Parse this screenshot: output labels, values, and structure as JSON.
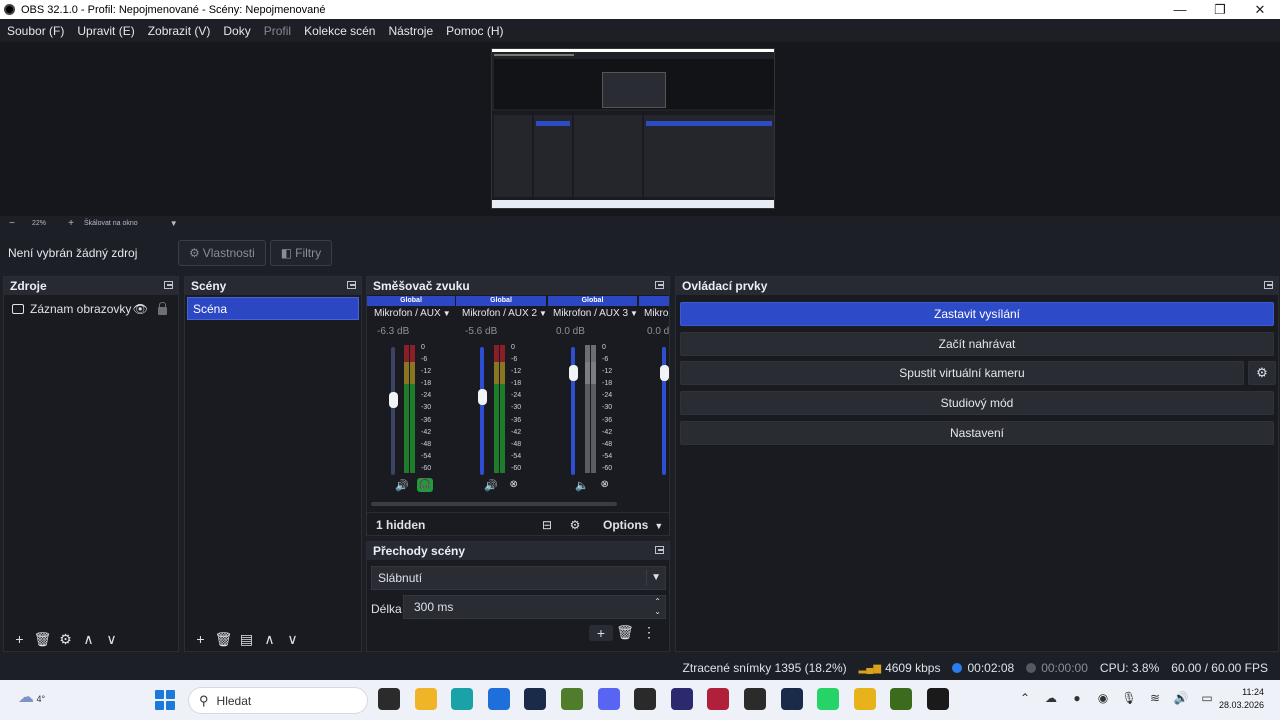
{
  "window": {
    "title": "OBS 32.1.0 - Profil: Nepojmenované - Scény: Nepojmenované",
    "minimize": "—",
    "maximize": "❐",
    "close": "✕"
  },
  "menu": [
    "Soubor (F)",
    "Upravit (E)",
    "Zobrazit (V)",
    "Doky",
    "Profil",
    "Kolekce scén",
    "Nástroje",
    "Pomoc (H)"
  ],
  "preview_bar": {
    "zoom_out": "−",
    "zoom": "22%",
    "zoom_in": "+",
    "scale_mode": "Škálovat na okno",
    "caret": "▼"
  },
  "source_bar": {
    "no_source": "Není vybrán žádný zdroj",
    "properties": "Vlastnosti",
    "filters": "Filtry",
    "properties_icon": "gear-icon",
    "filters_icon": "filter-icon"
  },
  "sources_dock": {
    "title": "Zdroje",
    "items": [
      {
        "label": "Záznam obrazovky",
        "icon": "monitor-icon",
        "visible": true,
        "locked": false
      }
    ],
    "toolbar": [
      "+",
      "🗑",
      "⚙",
      "∧",
      "∨"
    ]
  },
  "scenes_dock": {
    "title": "Scény",
    "items": [
      {
        "label": "Scéna",
        "selected": true
      }
    ],
    "toolbar": [
      "+",
      "🗑",
      "▤",
      "∧",
      "∨"
    ]
  },
  "mixer_dock": {
    "title": "Směšovač zvuku",
    "channels": [
      {
        "badge": "Global",
        "name": "Mikrofon / AUX",
        "volume": "-6.3 dB",
        "fader_level": 0.7,
        "muted": false,
        "monitoring": true
      },
      {
        "badge": "Global",
        "name": "Mikrofon / AUX 2",
        "volume": "-5.6 dB",
        "fader_level": 0.72,
        "muted": false,
        "monitoring": false
      },
      {
        "badge": "Global",
        "name": "Mikrofon / AUX 3",
        "volume": "0.0 dB",
        "fader_level": 1.0,
        "muted": true,
        "monitoring": false
      },
      {
        "badge": "Global",
        "name": "Mikro",
        "volume": "0.0 d",
        "fader_level": 1.0,
        "muted": true,
        "monitoring": false
      }
    ],
    "scale": [
      "0",
      "-6",
      "-12",
      "-18",
      "-24",
      "-30",
      "-36",
      "-42",
      "-48",
      "-54",
      "-60"
    ],
    "hidden": "1 hidden",
    "options": "Options",
    "caret": "▼"
  },
  "transitions_dock": {
    "title": "Přechody scény",
    "selected": "Slábnutí",
    "duration_label": "Délka",
    "duration_value": "300 ms",
    "caret": "▼",
    "spin_up": "⌃",
    "spin_down": "⌄",
    "tools": [
      "+",
      "🗑",
      "⋮"
    ]
  },
  "controls_dock": {
    "title": "Ovládací prvky",
    "buttons": [
      "Zastavit vysílání",
      "Začít nahrávat",
      "Spustit virtuální kameru",
      "Studiový mód",
      "Nastavení"
    ],
    "gear": "⚙"
  },
  "status": {
    "dropped": "Ztracené snímky 1395 (18.2%)",
    "bitrate": "4609 kbps",
    "stream_time": "00:02:08",
    "record_time": "00:00:00",
    "cpu": "CPU: 3.8%",
    "fps": "60.00 / 60.00 FPS"
  },
  "taskbar": {
    "temperature": "4°",
    "search_placeholder": "Hledat",
    "time": "11:24",
    "date": "28.03.2026",
    "app_colors": [
      "#2b2b2b",
      "#f0b429",
      "#1ba2a8",
      "#1e6fd9",
      "#1a2b4a",
      "#4f7d2c",
      "#5865f2",
      "#2a2a2a",
      "#2c2a6e",
      "#b0203a",
      "#2b2b2b",
      "#1a2b4a",
      "#25d366",
      "#e8b21a",
      "#3d6b1e",
      "#1a1a1a"
    ]
  },
  "colors": {
    "accent": "#2e4bc7",
    "background": "#1d1f26",
    "dock": "#1a1b21"
  }
}
